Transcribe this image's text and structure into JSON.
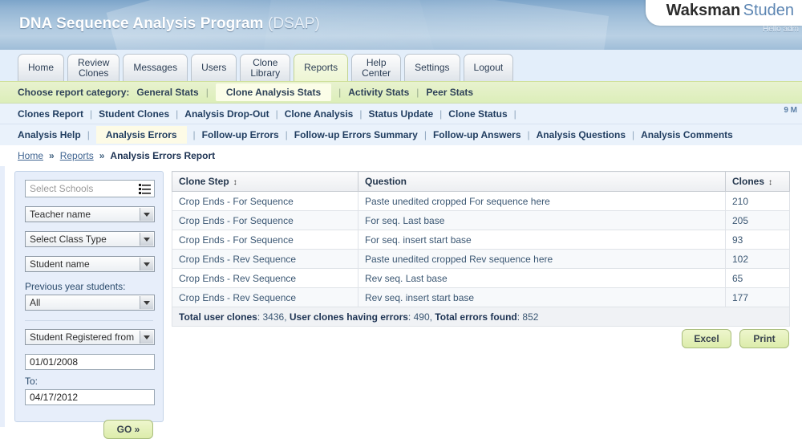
{
  "header": {
    "app_title_bold": "DNA Sequence Analysis Program",
    "app_title_light": "(DSAP)",
    "brand_bold": "Waksman",
    "brand_light": "Studen",
    "greeting": "Hello adm",
    "date": "9 M"
  },
  "tabs": [
    {
      "label": "Home",
      "active": false
    },
    {
      "label": "Review\nClones",
      "active": false
    },
    {
      "label": "Messages",
      "active": false
    },
    {
      "label": "Users",
      "active": false
    },
    {
      "label": "Clone\nLibrary",
      "active": false
    },
    {
      "label": "Reports",
      "active": true
    },
    {
      "label": "Help\nCenter",
      "active": false
    },
    {
      "label": "Settings",
      "active": false
    },
    {
      "label": "Logout",
      "active": false
    }
  ],
  "category_bar": {
    "label": "Choose report category:",
    "items": [
      {
        "label": "General Stats",
        "active": false
      },
      {
        "label": "Clone Analysis Stats",
        "active": true
      },
      {
        "label": "Activity Stats",
        "active": false
      },
      {
        "label": "Peer Stats",
        "active": false
      }
    ]
  },
  "subnav_row1": [
    {
      "label": "Clones Report",
      "active": false
    },
    {
      "label": "Student Clones",
      "active": false
    },
    {
      "label": "Analysis Drop-Out",
      "active": false
    },
    {
      "label": "Clone Analysis",
      "active": false
    },
    {
      "label": "Status Update",
      "active": false
    },
    {
      "label": "Clone Status",
      "active": false
    }
  ],
  "subnav_row2": [
    {
      "label": "Analysis Help",
      "active": false
    },
    {
      "label": "Analysis Errors",
      "active": true
    },
    {
      "label": "Follow-up Errors",
      "active": false
    },
    {
      "label": "Follow-up Errors Summary",
      "active": false
    },
    {
      "label": "Follow-up Answers",
      "active": false
    },
    {
      "label": "Analysis Questions",
      "active": false
    },
    {
      "label": "Analysis Comments",
      "active": false
    }
  ],
  "breadcrumb": {
    "home": "Home",
    "reports": "Reports",
    "current": "Analysis Errors Report",
    "separator": "»"
  },
  "sidebar": {
    "select_schools_placeholder": "Select Schools",
    "teacher_name": "Teacher name",
    "class_type": "Select Class Type",
    "student_name": "Student name",
    "previous_year_label": "Previous year students:",
    "previous_year_value": "All",
    "registered_from": "Student Registered from",
    "date_from": "01/01/2008",
    "to_label": "To:",
    "date_to": "04/17/2012",
    "go_label": "GO »"
  },
  "table": {
    "columns": [
      {
        "label": "Clone Step",
        "sortable": true
      },
      {
        "label": "Question",
        "sortable": false
      },
      {
        "label": "Clones",
        "sortable": true
      }
    ],
    "sort_glyph": "↕",
    "rows": [
      {
        "step": "Crop Ends - For Sequence",
        "question": "Paste unedited cropped For sequence here",
        "clones": "210"
      },
      {
        "step": "Crop Ends - For Sequence",
        "question": "For seq. Last base",
        "clones": "205"
      },
      {
        "step": "Crop Ends - For Sequence",
        "question": "For seq. insert start base",
        "clones": "93"
      },
      {
        "step": "Crop Ends - Rev Sequence",
        "question": "Paste unedited cropped Rev sequence here",
        "clones": "102"
      },
      {
        "step": "Crop Ends - Rev Sequence",
        "question": "Rev seq. Last base",
        "clones": "65"
      },
      {
        "step": "Crop Ends - Rev Sequence",
        "question": "Rev seq. insert start base",
        "clones": "177"
      }
    ],
    "totals": {
      "label1": "Total user clones",
      "value1": "3436",
      "label2": "User clones having errors",
      "value2": "490",
      "label3": "Total errors found",
      "value3": "852"
    }
  },
  "actions": {
    "excel": "Excel",
    "print": "Print"
  },
  "colors": {
    "accent_green": "#dcecab",
    "header_blue": "#a9c5dd",
    "link_blue": "#1f3c5f"
  }
}
